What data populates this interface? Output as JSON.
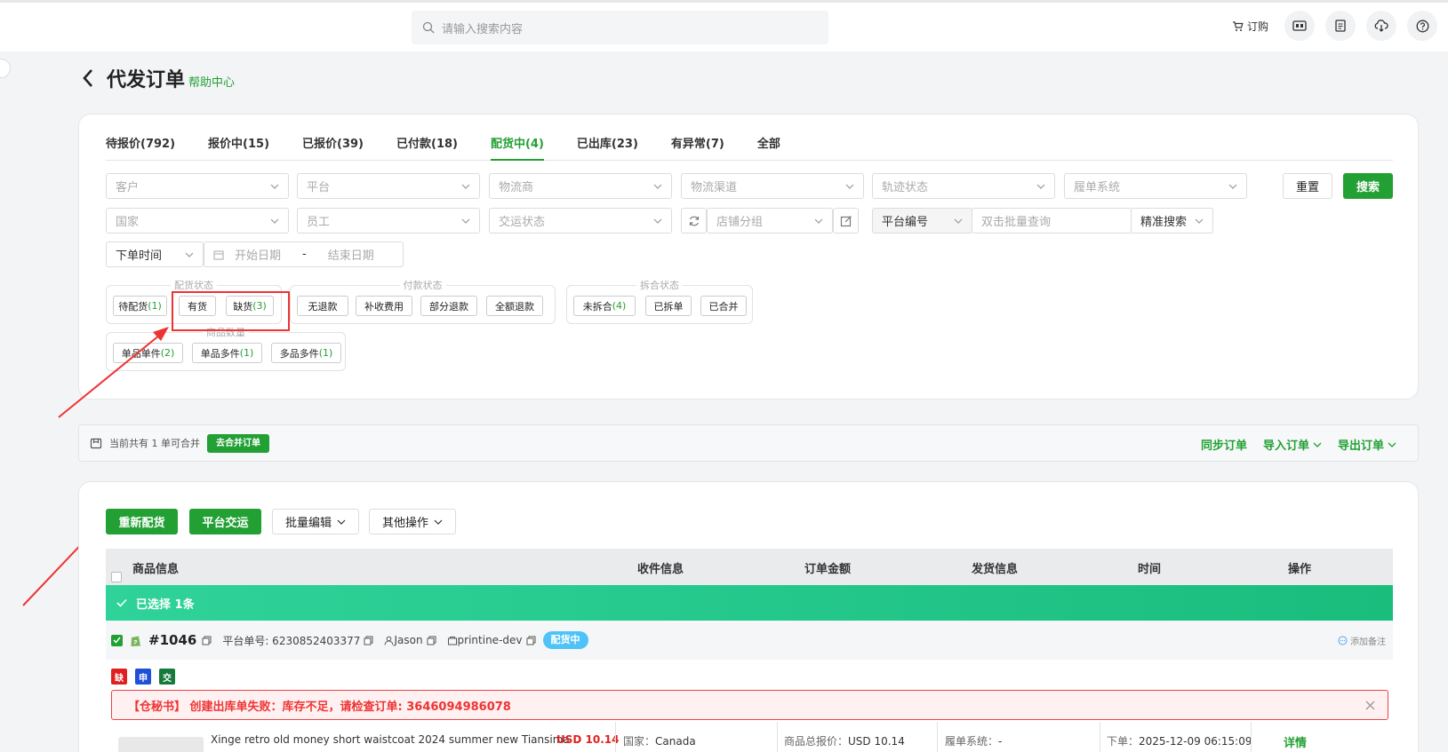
{
  "topbar": {
    "search_placeholder": "请输入搜索内容",
    "order_label": "订购",
    "icons": [
      "cart-icon",
      "app-icon",
      "document-icon",
      "cloud-download-icon",
      "help-icon"
    ]
  },
  "header": {
    "title": "代发订单",
    "help": "帮助中心"
  },
  "tabs": [
    {
      "label": "待报价(792)"
    },
    {
      "label": "报价中(15)"
    },
    {
      "label": "已报价(39)"
    },
    {
      "label": "已付款(18)"
    },
    {
      "label": "配货中(4)",
      "active": true
    },
    {
      "label": "已出库(23)"
    },
    {
      "label": "有异常(7)"
    },
    {
      "label": "全部"
    }
  ],
  "filters": {
    "customer": "客户",
    "platform": "平台",
    "logistics": "物流商",
    "channel": "物流渠道",
    "track_status": "轨迹状态",
    "fulfill_system": "履单系统",
    "country": "国家",
    "staff": "员工",
    "delivery_status": "交运状态",
    "store_group": "店铺分组",
    "platform_no": "平台编号",
    "batch_placeholder": "双击批量查询",
    "precise": "精准搜索",
    "order_time": "下单时间",
    "start_date": "开始日期",
    "date_sep": "-",
    "end_date": "结束日期",
    "reset": "重置",
    "search": "搜索"
  },
  "chip_groups": {
    "allocation": {
      "title": "配货状态",
      "chips": [
        {
          "label": "待配货",
          "count": "(1)"
        },
        {
          "label": "有货",
          "count": ""
        },
        {
          "label": "缺货",
          "count": "(3)"
        }
      ]
    },
    "payment": {
      "title": "付款状态",
      "chips": [
        {
          "label": "无退款"
        },
        {
          "label": "补收费用"
        },
        {
          "label": "部分退款"
        },
        {
          "label": "全额退款"
        }
      ]
    },
    "split": {
      "title": "拆合状态",
      "chips": [
        {
          "label": "未拆合",
          "count": "(4)"
        },
        {
          "label": "已拆单",
          "count": ""
        },
        {
          "label": "已合并",
          "count": ""
        }
      ]
    },
    "quantity": {
      "title": "商品数量",
      "chips": [
        {
          "label": "单品单件",
          "count": "(2)"
        },
        {
          "label": "单品多件",
          "count": "(1)"
        },
        {
          "label": "多品多件",
          "count": "(1)"
        }
      ]
    }
  },
  "infobar": {
    "text": "当前共有 1 单可合并",
    "merge": "去合并订单",
    "sync": "同步订单",
    "import": "导入订单",
    "export": "导出订单"
  },
  "actions": {
    "reallocate": "重新配货",
    "platform_delivery": "平台交运",
    "batch_edit": "批量编辑",
    "other": "其他操作"
  },
  "table": {
    "columns": [
      "商品信息",
      "收件信息",
      "订单金额",
      "发货信息",
      "时间",
      "操作"
    ],
    "selected_text": "已选择 1条"
  },
  "order": {
    "no": "#1046",
    "platform_no": "平台单号: 6230852403377",
    "user": "Jason",
    "store": "printine-dev",
    "status": "配货中",
    "remark": "添加备注",
    "tags": [
      {
        "t": "缺",
        "c": "#e02020"
      },
      {
        "t": "申",
        "c": "#1e50d8"
      },
      {
        "t": "交",
        "c": "#157a3a"
      }
    ],
    "alert": "【仓秘书】 创建出库单失败：库存不足，请检查订单: 3646094986078",
    "product_title": "Xinge retro old money short waistcoat 2024 summer new Tiansima",
    "price": "USD 10.14",
    "country_label": "国家：",
    "country": "Canada",
    "total_label": "商品总报价：",
    "total": "USD 10.14",
    "fulfill_label": "履单系统：",
    "fulfill": "-",
    "order_time_label": "下单：",
    "order_time": "2025-12-09 06:15:09",
    "detail": "详情"
  },
  "colors": {
    "accent": "#22a034",
    "alert_red": "#e84545",
    "pill_blue": "#4fc3f7"
  }
}
